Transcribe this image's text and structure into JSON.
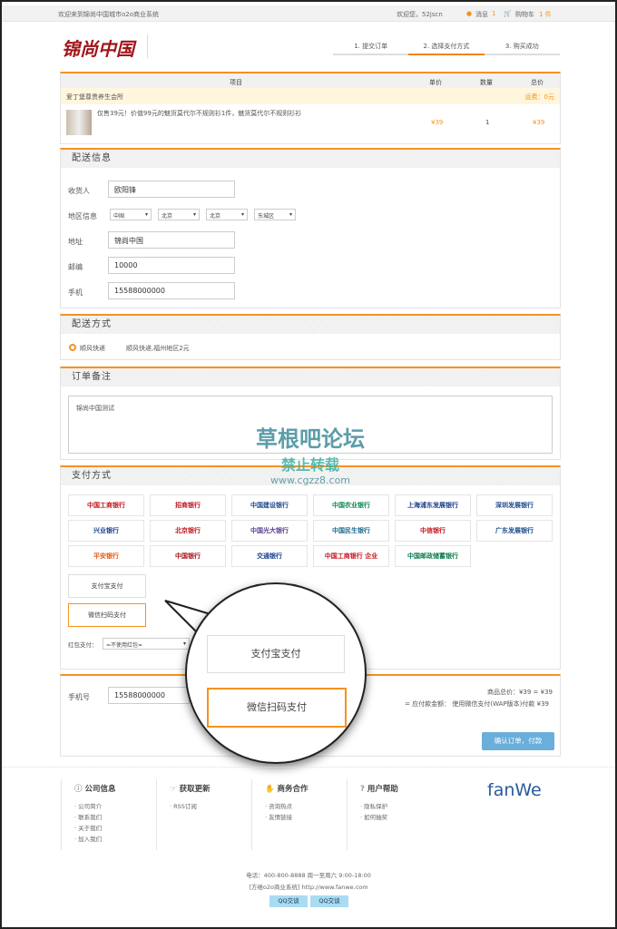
{
  "topbar": {
    "welcome": "欢迎来到锦尚中国城市o2o商业系统",
    "user": "欢迎您，52jscn",
    "messages": "消息",
    "msg_count": "1",
    "cart": "购物车",
    "cart_count": "1 件"
  },
  "logo": "锦尚中国",
  "steps": [
    "1. 提交订单",
    "2. 选择支付方式",
    "3. 购买成功"
  ],
  "order": {
    "headers": [
      "项目",
      "单价",
      "数量",
      "总价"
    ],
    "shop": "爱丁堡尊贵养生会所",
    "shipping": "运费：0元",
    "item": {
      "name": "仅售39元！价值99元的魅货莫代尔不规则衫1件，魅货莫代尔不规则衫衫",
      "price": "¥39",
      "qty": "1",
      "total": "¥39"
    }
  },
  "delivery": {
    "title": "配送信息",
    "receiver_label": "收货人",
    "receiver": "欧阳锋",
    "region_label": "地区信息",
    "regions": [
      "中国",
      "北京",
      "北京",
      "东城区"
    ],
    "address_label": "地址",
    "address": "锦尚中国",
    "zip_label": "邮编",
    "zip": "10000",
    "phone_label": "手机",
    "phone": "15588000000"
  },
  "shipping_method": {
    "title": "配送方式",
    "option": "顺风快递",
    "desc": "顺风快递,福州地区2元"
  },
  "remark": {
    "title": "订单备注",
    "text": "锦尚中国测试"
  },
  "payment": {
    "title": "支付方式",
    "banks": [
      "中国工商银行",
      "招商银行",
      "中国建设银行",
      "中国农业银行",
      "上海浦东发展银行",
      "深圳发展银行",
      "兴业银行",
      "北京银行",
      "中国光大银行",
      "中国民生银行",
      "中信银行",
      "广东发展银行",
      "平安银行",
      "中国银行",
      "交通银行",
      "中国工商银行 企业",
      "中国邮政储蓄银行"
    ],
    "alipay": "支付宝支付",
    "wechat": "微信扫码支付",
    "redpacket_label": "红包支付：",
    "redpacket": "=不使用红包="
  },
  "summary": {
    "phone_label": "手机号",
    "phone": "15588000000",
    "total": "商品总价：¥39 = ¥39",
    "payable": "= 应付款金额： 使用微信支付(WAP版本)付款 ¥39",
    "confirm": "确认订单，付款"
  },
  "zoom_callout": {
    "alipay": "支付宝支付",
    "wechat": "微信扫码支付"
  },
  "watermark": {
    "line1": "草根吧论坛",
    "line2": "禁止转载",
    "line3": "www.cgzz8.com"
  },
  "footer": {
    "cols": [
      {
        "title": "公司信息",
        "links": [
          "公司简介",
          "联系我们",
          "关于我们",
          "加入我们"
        ]
      },
      {
        "title": "获取更新",
        "links": [
          "RSS订阅"
        ]
      },
      {
        "title": "商务合作",
        "links": [
          "咨询热点",
          "友情链接"
        ]
      },
      {
        "title": "用户帮助",
        "links": [
          "隐私保护",
          "如何抽奖"
        ]
      }
    ],
    "brand": "fanWe",
    "tel": "电话：400-800-8888 周一至周六 9:00-18:00",
    "site": "[方维o2o商业系统] http://www.fanwe.com",
    "qq": [
      "QQ交谈",
      "QQ交谈"
    ]
  },
  "colors": {
    "accent": "#f5921f",
    "brand": "#a0151b",
    "button": "#6aaedb"
  }
}
